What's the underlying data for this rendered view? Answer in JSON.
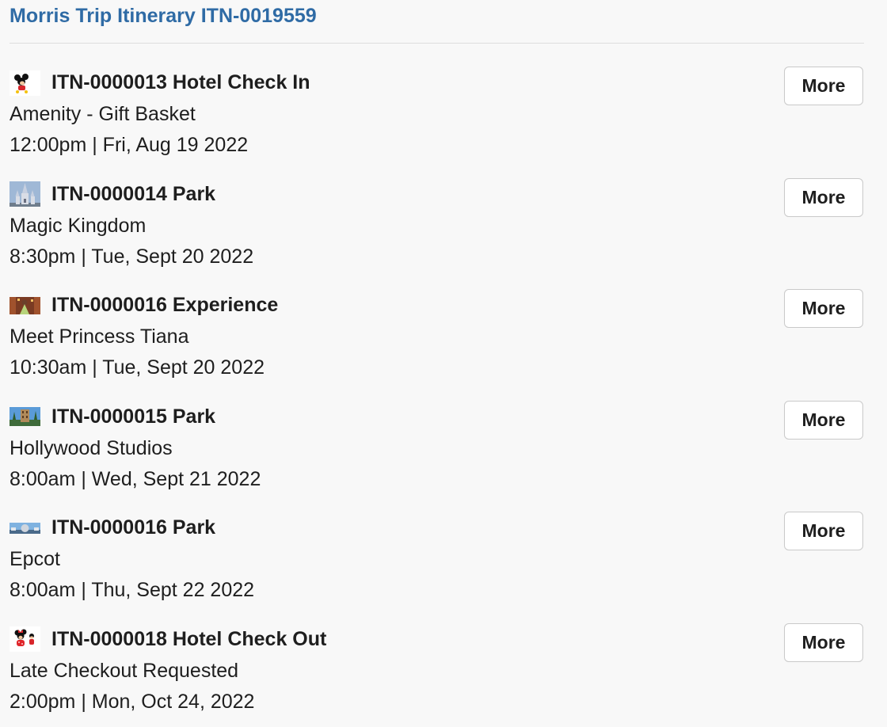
{
  "header": {
    "title": "Morris Trip Itinerary ITN-0019559"
  },
  "colors": {
    "link": "#2f6ba5",
    "text": "#1e1e1e",
    "background": "#f8f8f8",
    "divider": "#dddddd"
  },
  "items": [
    {
      "icon": "mickey-thumbnail",
      "title": "ITN-0000013 Hotel Check In",
      "subtitle": "Amenity - Gift Basket",
      "time": "12:00pm | Fri, Aug 19 2022",
      "button": "More"
    },
    {
      "icon": "castle-thumbnail",
      "title": "ITN-0000014 Park",
      "subtitle": "Magic Kingdom",
      "time": "8:30pm | Tue, Sept 20 2022",
      "button": "More"
    },
    {
      "icon": "princess-thumbnail",
      "title": "ITN-0000016 Experience",
      "subtitle": "Meet Princess Tiana",
      "time": "10:30am | Tue, Sept 20 2022",
      "button": "More"
    },
    {
      "icon": "studios-thumbnail",
      "title": "ITN-0000015 Park",
      "subtitle": "Hollywood Studios",
      "time": "8:00am | Wed, Sept 21 2022",
      "button": "More"
    },
    {
      "icon": "epcot-thumbnail",
      "title": "ITN-0000016 Park",
      "subtitle": "Epcot",
      "time": "8:00am | Thu, Sept 22 2022",
      "button": "More"
    },
    {
      "icon": "minnie-thumbnail",
      "title": "ITN-0000018 Hotel Check Out",
      "subtitle": "Late Checkout Requested",
      "time": "2:00pm | Mon, Oct 24, 2022",
      "button": "More"
    }
  ]
}
